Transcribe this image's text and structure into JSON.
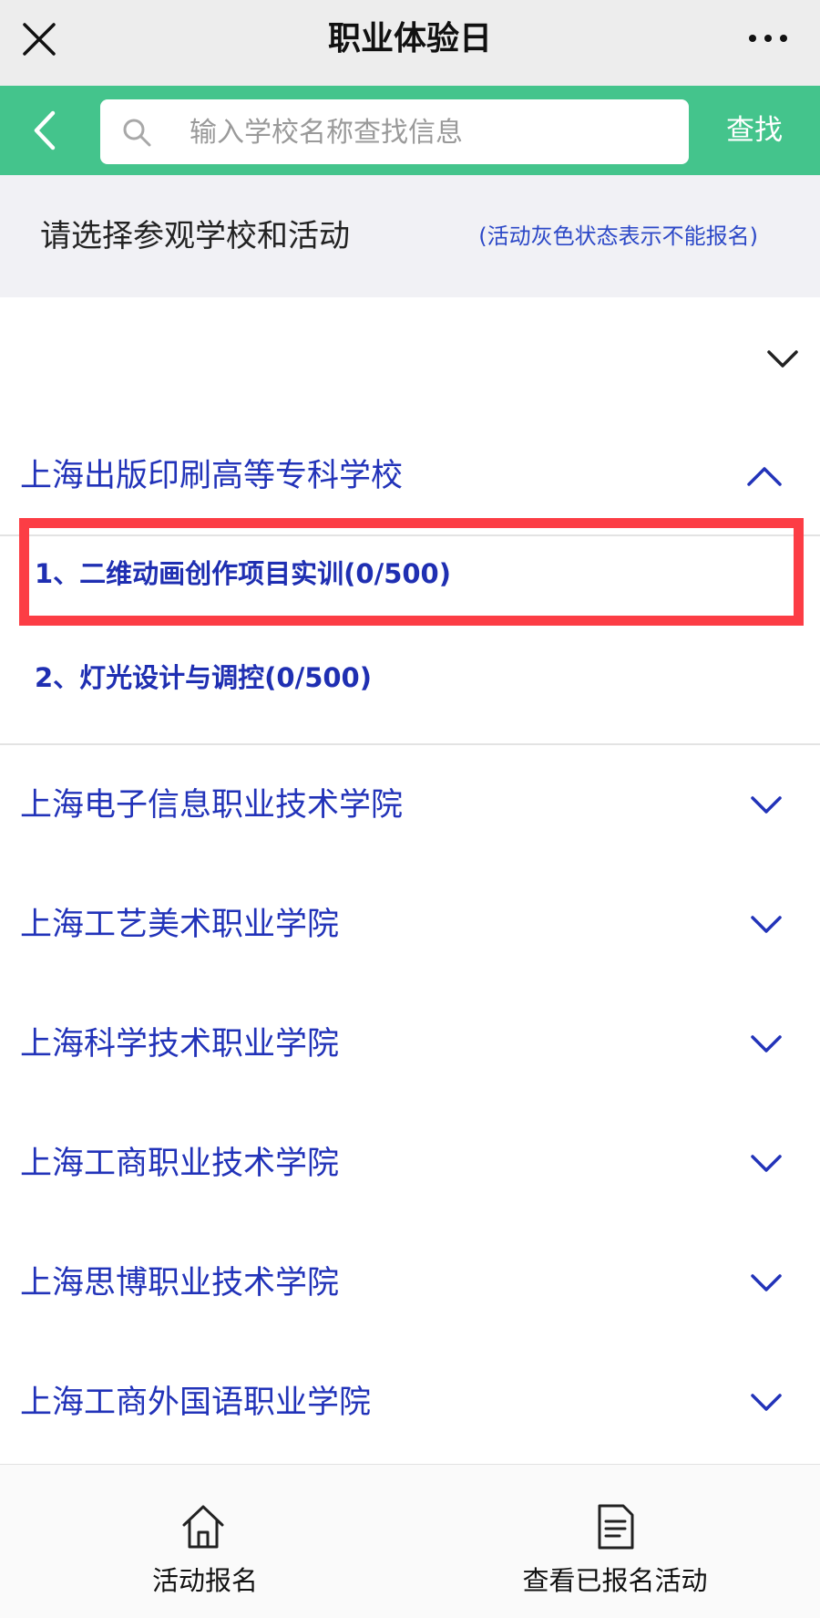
{
  "window": {
    "title": "职业体验日",
    "close_icon": "close-icon",
    "more_icon": "more-horizontal-icon"
  },
  "search": {
    "back_icon": "chevron-left-icon",
    "search_icon": "search-icon",
    "placeholder": "输入学校名称查找信息",
    "value": "",
    "button_label": "查找"
  },
  "hint": {
    "main": "请选择参观学校和活动",
    "note": "(活动灰色状态表示不能报名)"
  },
  "schools": [
    {
      "name": "上海出版印刷高等专科学校",
      "expanded": true,
      "activities": [
        {
          "label": "1、二维动画创作项目实训(0/500)",
          "highlighted": true
        },
        {
          "label": "2、灯光设计与调控(0/500)",
          "highlighted": false
        }
      ]
    },
    {
      "name": "上海电子信息职业技术学院",
      "expanded": false
    },
    {
      "name": "上海工艺美术职业学院",
      "expanded": false
    },
    {
      "name": "上海科学技术职业学院",
      "expanded": false
    },
    {
      "name": "上海工商职业技术学院",
      "expanded": false
    },
    {
      "name": "上海思博职业技术学院",
      "expanded": false
    },
    {
      "name": "上海工商外国语职业学院",
      "expanded": false
    }
  ],
  "footer": {
    "tabs": [
      {
        "label": "活动报名",
        "icon": "home-icon"
      },
      {
        "label": "查看已报名活动",
        "icon": "document-icon"
      }
    ]
  },
  "colors": {
    "accent_green": "#44c48c",
    "link_blue": "#2233b9",
    "highlight_red": "#fc3d45"
  }
}
